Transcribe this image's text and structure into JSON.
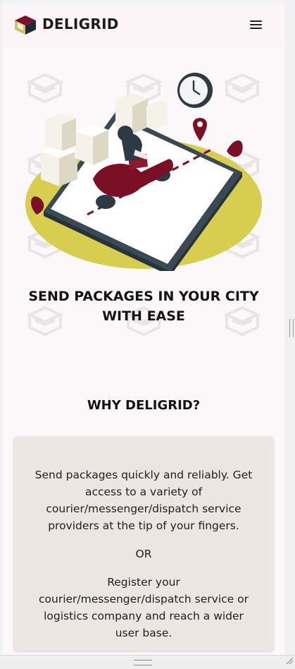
{
  "header": {
    "brand_name": "DELIGRID",
    "logo_icon": "deligrid-box-logo-icon",
    "menu_icon": "hamburger-menu-icon"
  },
  "hero": {
    "illustration": "delivery-scooter-on-phone-illustration",
    "title": "SEND PACKAGES IN YOUR CITY WITH EASE"
  },
  "why": {
    "title": "WHY DELIGRID?",
    "card": {
      "paragraph_1": "Send packages quickly and reliably. Get access to a variety of courier/messenger/dispatch service providers at the tip of your fingers.",
      "separator": "OR",
      "paragraph_2": "Register your courier/messenger/dispatch service or logistics company and reach a wider user base."
    }
  },
  "colors": {
    "brand_maroon": "#7a0f25",
    "accent_yellow": "#d7cd4f",
    "card_background": "#ebe6e1",
    "page_background": "#fcf8f9"
  }
}
